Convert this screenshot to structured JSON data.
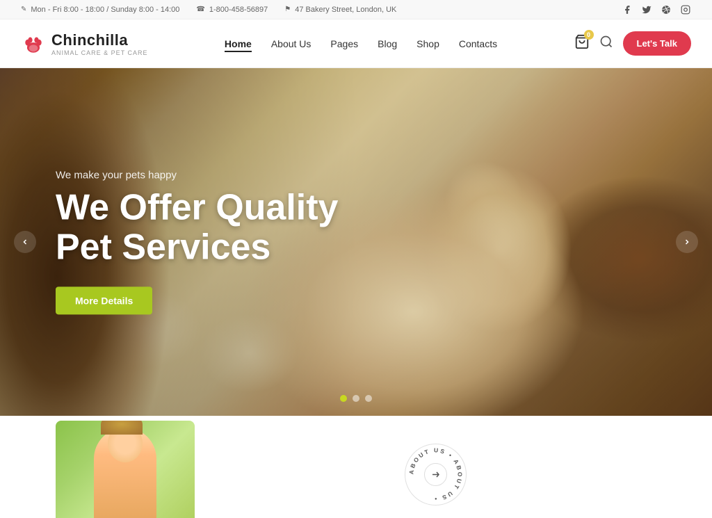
{
  "topbar": {
    "schedule": "Mon - Fri 8:00 - 18:00 / Sunday 8:00 - 14:00",
    "phone": "1-800-458-56897",
    "address": "47 Bakery Street, London, UK"
  },
  "social": {
    "facebook": "f",
    "twitter": "t",
    "dribbble": "d",
    "instagram": "i"
  },
  "header": {
    "logo_name": "Chinchilla",
    "logo_tagline": "Animal Care & Pet Care",
    "nav_items": [
      {
        "label": "Home",
        "active": true
      },
      {
        "label": "About Us",
        "active": false
      },
      {
        "label": "Pages",
        "active": false
      },
      {
        "label": "Blog",
        "active": false
      },
      {
        "label": "Shop",
        "active": false
      },
      {
        "label": "Contacts",
        "active": false
      }
    ],
    "cta_button": "Let's Talk"
  },
  "hero": {
    "subtitle": "We make your pets happy",
    "title": "We Offer Quality\nPet Services",
    "cta_button": "More Details",
    "dots": 3,
    "active_dot": 0
  },
  "about_circle": "ABOUT US"
}
